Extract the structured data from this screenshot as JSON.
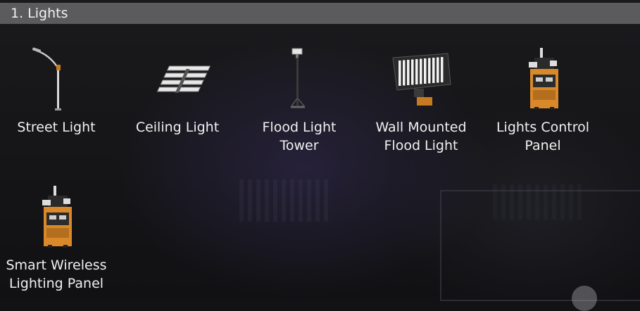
{
  "section": {
    "title": "1. Lights"
  },
  "items": [
    {
      "label": "Street Light",
      "icon": "street-light-icon"
    },
    {
      "label": "Ceiling Light",
      "icon": "ceiling-light-icon"
    },
    {
      "label": "Flood Light\nTower",
      "icon": "flood-light-tower-icon"
    },
    {
      "label": "Wall Mounted\nFlood Light",
      "icon": "wall-mounted-flood-light-icon"
    },
    {
      "label": "Lights Control\nPanel",
      "icon": "lights-control-panel-icon"
    },
    {
      "label": "Smart Wireless\nLighting Panel",
      "icon": "smart-wireless-lighting-panel-icon"
    }
  ],
  "colors": {
    "header_bg": "#5b5b5e",
    "text": "#f0f0f0",
    "panel_orange": "#d9892a"
  }
}
